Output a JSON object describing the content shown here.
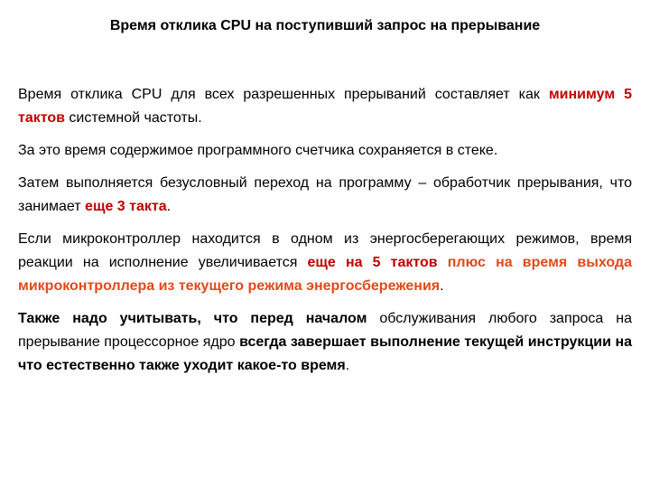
{
  "slide": {
    "title": "Время отклика CPU на поступивший запрос на прерывание",
    "paragraphs": [
      {
        "text1": "Время отклика CPU для всех разрешенных прерываний составляет как ",
        "red": "минимум 5 тактов",
        "text2": " системной частоты."
      },
      {
        "text1": "За это время содержимое программного счетчика сохраняется в стеке."
      },
      {
        "text1": "Затем выполняется безусловный переход на программу – обработчик прерывания, что занимает ",
        "red": "еще 3 такта",
        "text2": "."
      },
      {
        "text1": "Если микроконтроллер находится в одном из энергосберегающих режимов, время реакции на исполнение увеличивается ",
        "red": "еще на 5 тактов",
        "orange": " плюс на время выхода микроконтроллера из текущего режима энергосбережения",
        "text2": "."
      },
      {
        "bold1": "Также надо учитывать, что перед началом",
        "text1": " обслуживания любого запроса на прерывание процессорное ядро ",
        "bold2": "всегда завершает выполнение текущей инструкции на что естественно также уходит какое-то время",
        "text2": "."
      }
    ]
  },
  "colors": {
    "highlight_dark_red": "#c00000",
    "highlight_orange_red": "#e04a1c"
  }
}
